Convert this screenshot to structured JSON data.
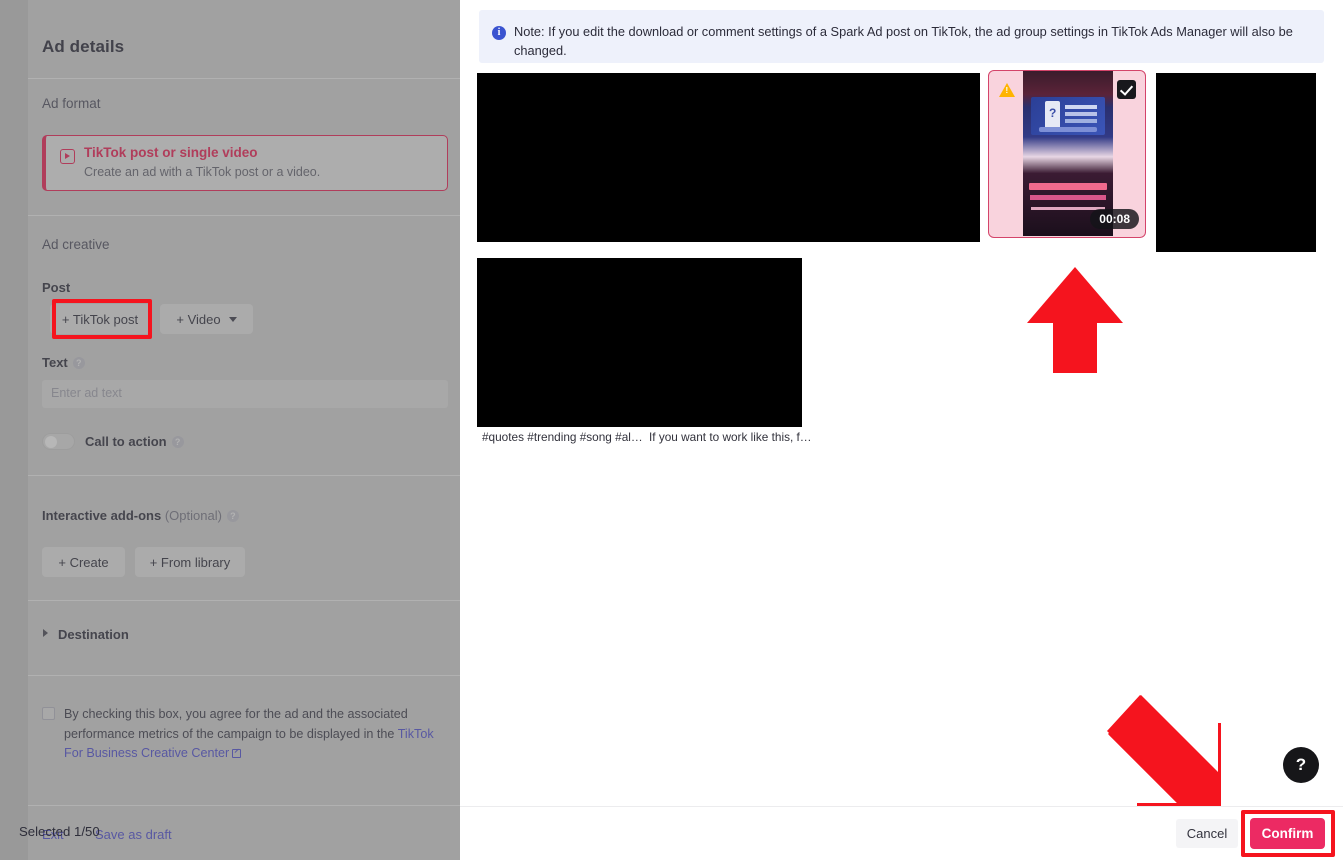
{
  "background_page": {
    "title": "Ad details",
    "ad_format": {
      "label": "Ad format",
      "card_title": "TikTok post or single video",
      "card_desc": "Create an ad with a TikTok post or a video.",
      "icon": "video-frame-icon"
    },
    "ad_creative": {
      "label": "Ad creative",
      "post_label": "Post",
      "tiktok_post_button": "+ TikTok post",
      "video_button": "+ Video",
      "video_chevron": "chevron-down-icon",
      "text_label": "Text",
      "text_placeholder": "Enter ad text",
      "cta_label": "Call to action"
    },
    "interactive_addons": {
      "label": "Interactive add-ons",
      "optional": "(Optional)",
      "create_button": "+ Create",
      "from_library_button": "+ From library"
    },
    "destination": {
      "label": "Destination",
      "icon": "chevron-right-icon"
    },
    "agreement": {
      "text_line1": "By checking this box, you agree for the ad and the associated",
      "text_line2": "performance metrics of the campaign to be displayed in the",
      "link": "TikTok For Business Creative Center",
      "link_icon": "external-link-icon",
      "checked": false
    },
    "footer": {
      "exit": "Exit",
      "save_as_draft": "Save as draft"
    }
  },
  "modal": {
    "note": {
      "icon": "info-icon",
      "text": "Note: If you edit the download or comment settings of a Spark Ad post on TikTok, the ad group settings in TikTok Ads Manager will also be changed."
    },
    "posts": {
      "selected_card": {
        "duration": "00:08",
        "warning_icon": "warning-triangle-icon",
        "checkbox_icon": "checkbox-checked-icon",
        "selected": true
      },
      "captions": [
        "#quotes #trending #song #al…",
        "If you want to work like this, f…"
      ]
    },
    "help_button": {
      "icon": "question-mark-icon",
      "label": "?"
    },
    "footer": {
      "selected_count": "Selected 1/50",
      "cancel": "Cancel",
      "confirm": "Confirm"
    }
  },
  "annotations": {
    "arrow_up": "red-arrow-up",
    "arrow_diagonal": "red-arrow-down-right",
    "highlight_tiktok_post": "red-highlight-box",
    "highlight_confirm": "red-highlight-box"
  },
  "colors": {
    "brand_pink": "#ec2a63",
    "format_accent": "#c9254f",
    "annotation_red": "#f5141e",
    "note_bg": "#eef1fb",
    "link_blue": "#4b4bb5"
  }
}
